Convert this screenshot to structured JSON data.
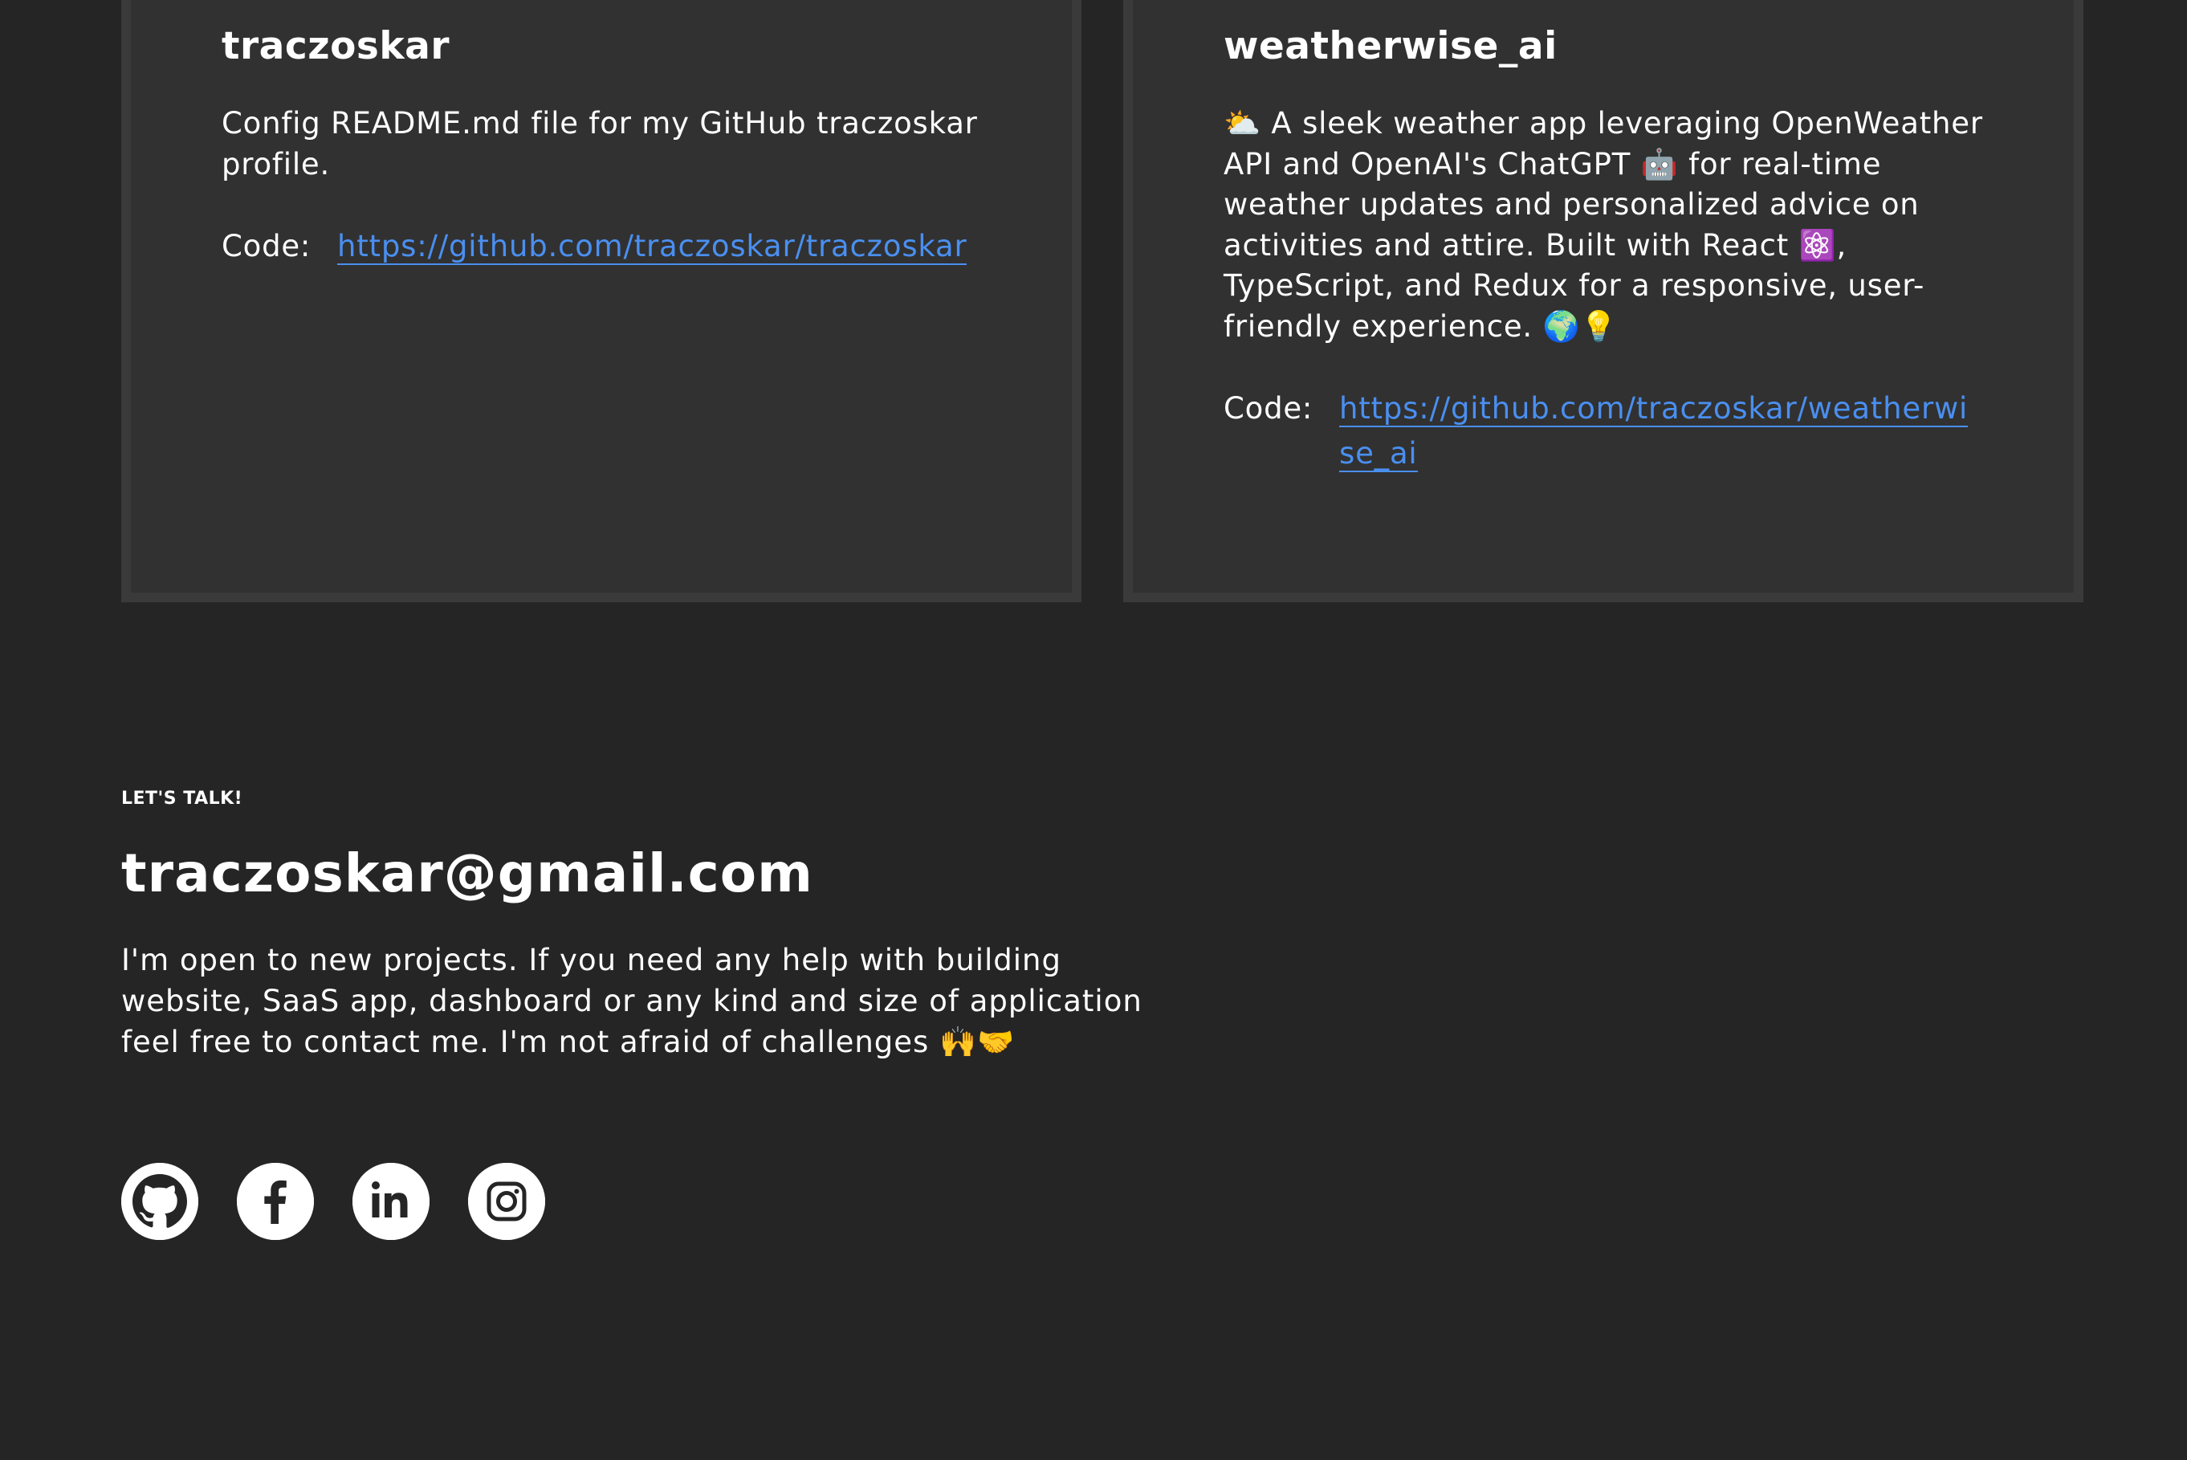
{
  "projects": [
    {
      "title": "traczoskar",
      "description": "Config README.md file for my GitHub traczoskar profile.",
      "code_label": "Code:",
      "code_url": "https://github.com/traczoskar/traczoskar"
    },
    {
      "title": "weatherwise_ai",
      "description": "⛅ A sleek weather app leveraging OpenWeather API and OpenAI's ChatGPT 🤖 for real-time weather updates and personalized advice on activities and attire. Built with React ⚛️, TypeScript, and Redux for a responsive, user-friendly experience. 🌍💡",
      "code_label": "Code:",
      "code_url": "https://github.com/traczoskar/weatherwise_ai"
    }
  ],
  "contact": {
    "eyebrow": "LET'S TALK!",
    "email": "traczoskar@gmail.com",
    "blurb": "I'm open to new projects. If you need any help with building website, SaaS app, dashboard or any kind and size of application feel free to contact me. I'm not afraid of challenges 🙌🤝"
  },
  "socials": [
    {
      "icon": "github-icon"
    },
    {
      "icon": "facebook-icon"
    },
    {
      "icon": "linkedin-icon"
    },
    {
      "icon": "instagram-icon"
    }
  ],
  "colors": {
    "background": "#252525",
    "card": "#313131",
    "card_border": "#3a3a3a",
    "link": "#4a8ff0",
    "text": "#ffffff"
  }
}
